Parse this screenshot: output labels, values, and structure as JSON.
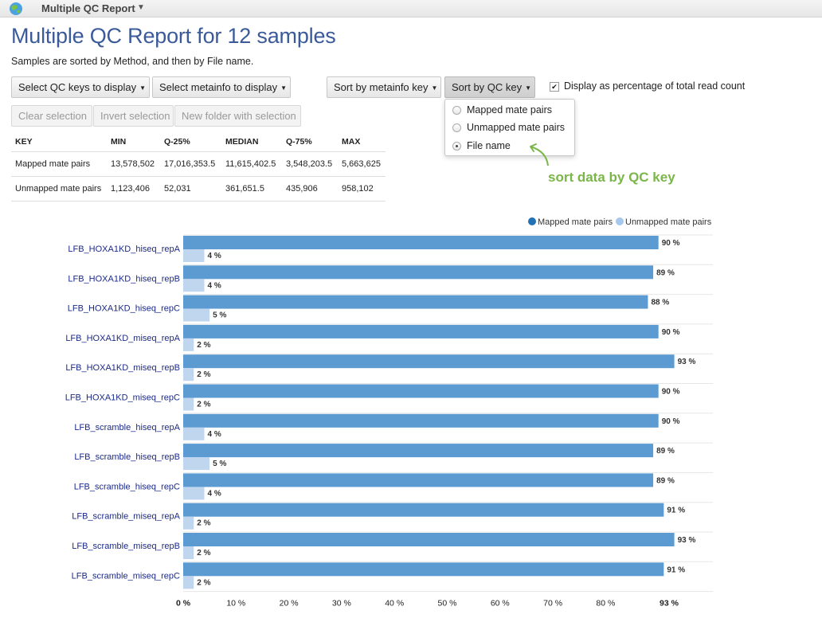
{
  "app": {
    "title": "Multiple QC Report"
  },
  "page": {
    "title": "Multiple QC Report for 12 samples",
    "subtitle": "Samples are sorted by Method, and then by File name."
  },
  "toolbar": {
    "select_qc_keys": "Select QC keys to display",
    "select_metainfo": "Select metainfo to display",
    "sort_by_metainfo": "Sort by metainfo key",
    "sort_by_qc": "Sort by QC key",
    "display_percentage": "Display as percentage of total read count",
    "display_percentage_checked": true,
    "clear_selection": "Clear selection",
    "invert_selection": "Invert selection",
    "new_folder": "New folder with selection"
  },
  "sort_dropdown": {
    "options": [
      "Mapped mate pairs",
      "Unmapped mate pairs",
      "File name"
    ],
    "selected": "File name"
  },
  "annotation": "sort data by QC key",
  "stats_table": {
    "headers": [
      "KEY",
      "MIN",
      "Q-25%",
      "MEDIAN",
      "Q-75%",
      "MAX"
    ],
    "rows": [
      [
        "Mapped mate pairs",
        "13,578,502",
        "17,016,353.5",
        "11,615,402.5",
        "3,548,203.5",
        "5,663,625"
      ],
      [
        "Unmapped mate pairs",
        "1,123,406",
        "52,031",
        "361,651.5",
        "435,906",
        "958,102"
      ]
    ]
  },
  "chart_data": {
    "type": "bar",
    "orientation": "horizontal",
    "categories": [
      "LFB_HOXA1KD_hiseq_repA",
      "LFB_HOXA1KD_hiseq_repB",
      "LFB_HOXA1KD_hiseq_repC",
      "LFB_HOXA1KD_miseq_repA",
      "LFB_HOXA1KD_miseq_repB",
      "LFB_HOXA1KD_miseq_repC",
      "LFB_scramble_hiseq_repA",
      "LFB_scramble_hiseq_repB",
      "LFB_scramble_hiseq_repC",
      "LFB_scramble_miseq_repA",
      "LFB_scramble_miseq_repB",
      "LFB_scramble_miseq_repC"
    ],
    "series": [
      {
        "name": "Mapped mate pairs",
        "color": "#5b9bd1",
        "values": [
          90,
          89,
          88,
          90,
          93,
          90,
          90,
          89,
          89,
          91,
          93,
          91
        ]
      },
      {
        "name": "Unmapped mate pairs",
        "color": "#c0d6ef",
        "values": [
          4,
          4,
          5,
          2,
          2,
          2,
          4,
          5,
          4,
          2,
          2,
          2
        ]
      }
    ],
    "x_ticks": [
      "0 %",
      "10 %",
      "20 %",
      "30 %",
      "40 %",
      "50 %",
      "60 %",
      "70 %",
      "80 %",
      "93 %"
    ],
    "xlim": [
      0,
      100
    ],
    "legend_position": "top-right",
    "legend_marker_colors": [
      "#2171b5",
      "#a6c8ec"
    ],
    "value_suffix": " %"
  }
}
